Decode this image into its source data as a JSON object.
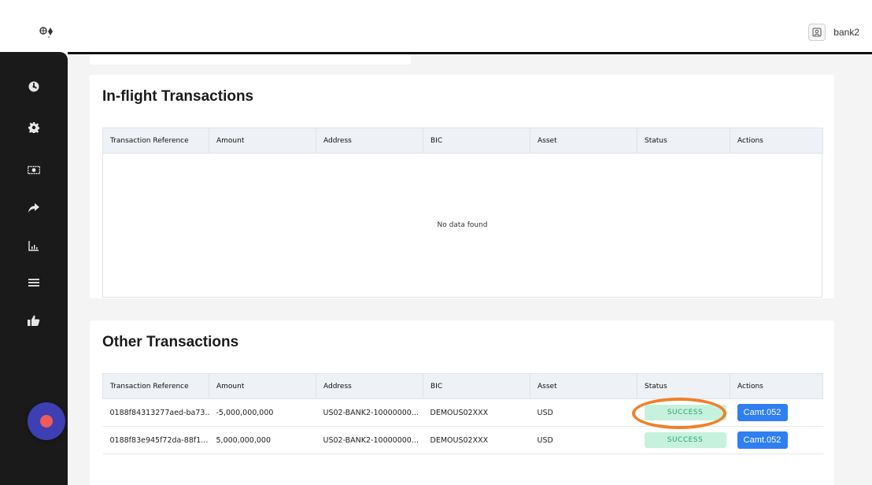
{
  "header": {
    "user_name": "bank2",
    "logo_icon": "logo-icon",
    "user_icon": "user-badge-icon"
  },
  "sidebar": {
    "items": [
      {
        "icon": "dashboard-icon"
      },
      {
        "icon": "gear-icon"
      },
      {
        "icon": "money-icon"
      },
      {
        "icon": "share-arrow-icon"
      },
      {
        "icon": "bar-chart-icon"
      },
      {
        "icon": "list-icon"
      },
      {
        "icon": "thumbs-up-icon"
      }
    ]
  },
  "inflight": {
    "title": "In-flight Transactions",
    "columns": [
      "Transaction Reference",
      "Amount",
      "Address",
      "BIC",
      "Asset",
      "Status",
      "Actions"
    ],
    "empty_text": "No data found"
  },
  "other": {
    "title": "Other Transactions",
    "columns": [
      "Transaction Reference",
      "Amount",
      "Address",
      "BIC",
      "Asset",
      "Status",
      "Actions"
    ],
    "rows": [
      {
        "ref": "0188f84313277aed-ba73...",
        "amount": "-5,000,000,000",
        "address": "US02-BANK2-10000000...",
        "bic": "DEMOUS02XXX",
        "asset": "USD",
        "status": "SUCCESS",
        "action": "Camt.052"
      },
      {
        "ref": "0188f83e945f72da-88f1...",
        "amount": "5,000,000,000",
        "address": "US02-BANK2-10000000...",
        "bic": "DEMOUS02XXX",
        "asset": "USD",
        "status": "SUCCESS",
        "action": "Camt.052"
      }
    ]
  },
  "colors": {
    "accent": "#2f7ff0",
    "success_bg": "#c6f2dd",
    "success_text": "#2aa36b",
    "highlight": "#f0802a",
    "sidebar_bg": "#1a1a1a"
  }
}
